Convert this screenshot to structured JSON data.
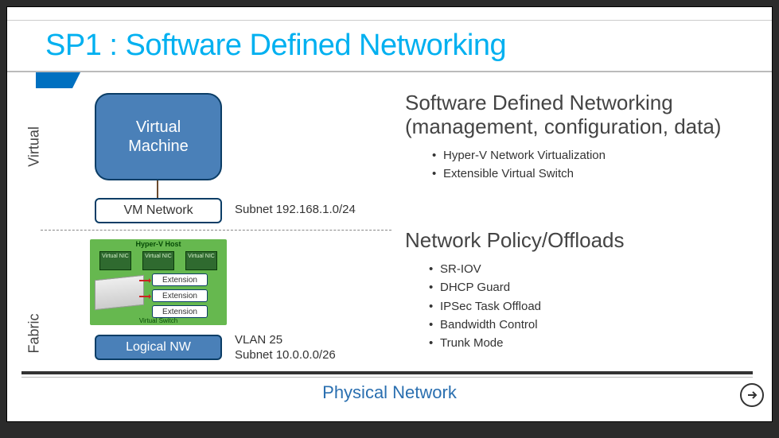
{
  "title": "SP1 : Software Defined Networking",
  "side_labels": {
    "virtual": "Virtual",
    "fabric": "Fabric"
  },
  "vm_box": "Virtual\nMachine",
  "vm_network": "VM Network",
  "subnet1": "Subnet 192.168.1.0/24",
  "host": {
    "title": "Hyper-V Host",
    "nic_label": "Virtual NIC",
    "extensions": [
      "Extension",
      "Extension",
      "Extension"
    ],
    "vswitch": "Virtual Switch"
  },
  "logical_nw": "Logical NW",
  "vlan": {
    "line1": "VLAN 25",
    "line2": "Subnet 10.0.0.0/26"
  },
  "physical": "Physical Network",
  "sdn": {
    "heading_line1": "Software Defined Networking",
    "heading_line2": "(management, configuration, data)",
    "items": [
      "Hyper-V Network Virtualization",
      "Extensible Virtual Switch"
    ]
  },
  "offloads": {
    "heading": "Network Policy/Offloads",
    "items": [
      "SR-IOV",
      "DHCP Guard",
      "IPSec Task Offload",
      "Bandwidth Control",
      "Trunk Mode"
    ]
  }
}
